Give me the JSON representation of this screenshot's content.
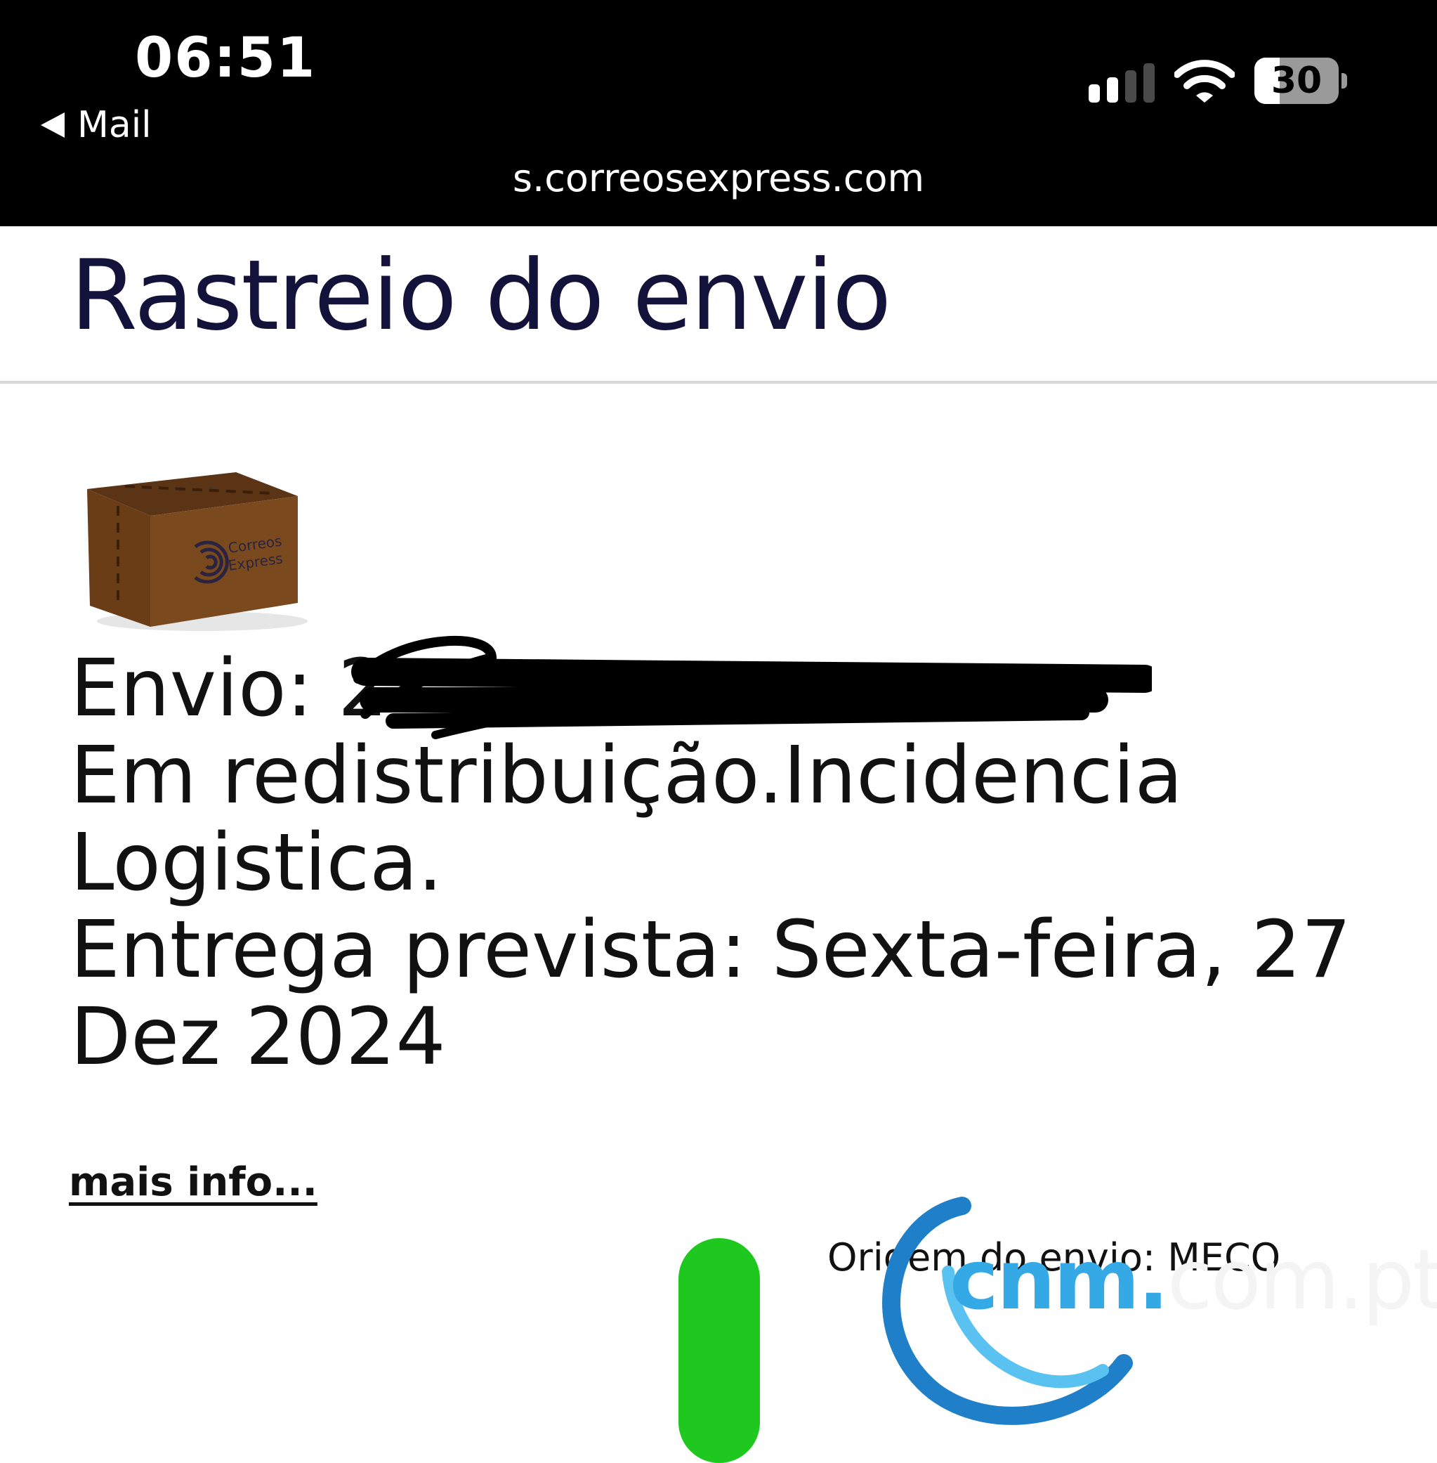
{
  "status_bar": {
    "time": "06:51",
    "back_label": "Mail",
    "battery_level": "30",
    "url": "s.correosexpress.com"
  },
  "page": {
    "title": "Rastreio do envio",
    "package_brand_lines": [
      "Correos",
      "Express"
    ],
    "shipment_label": "Envio: 2",
    "status_line_1": "Em redistribuição.Incidencia",
    "status_line_2": "Logistica.",
    "delivery_line_1": "Entrega prevista: Sexta-feira, 27",
    "delivery_line_2": "Dez 2024",
    "more_info_link": "mais info...",
    "origin_text": "Origem do envio: MECO"
  },
  "watermark": {
    "brand": "cnm.",
    "suffix": "com.pt"
  },
  "colors": {
    "status_bar_bg": "#000000",
    "title": "#12123a",
    "progress_green": "#1ec81e",
    "watermark_blue": "#35a9e6",
    "box_brown": "#7a4a1e"
  },
  "icons": {
    "signal": "cellular-signal-icon",
    "wifi": "wifi-icon",
    "battery": "battery-icon",
    "back": "back-arrow-icon"
  }
}
